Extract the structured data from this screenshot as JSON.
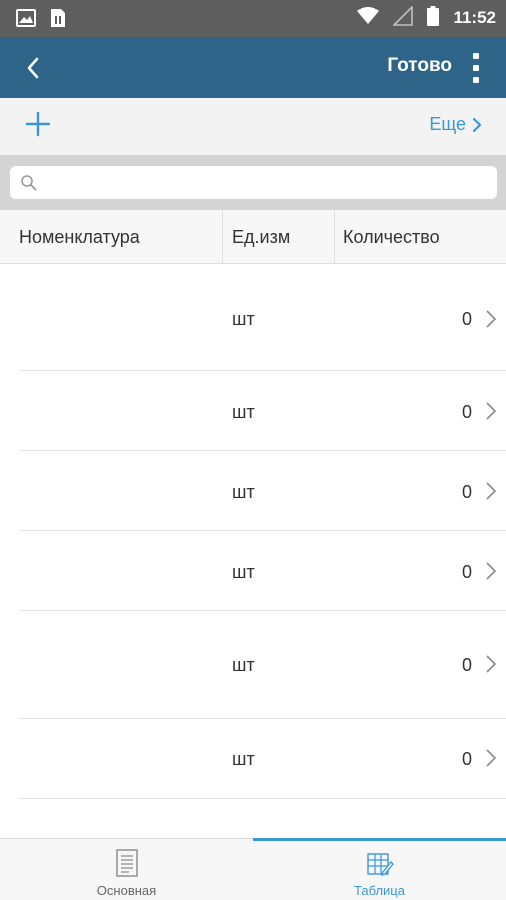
{
  "status_bar": {
    "time": "11:52",
    "icons": [
      "image-icon",
      "sim-card-icon",
      "wifi-icon",
      "signal-icon",
      "battery-icon"
    ]
  },
  "app_bar": {
    "back_icon": "chevron-left-icon",
    "done_label": "Готово",
    "menu_icon": "more-vertical-icon"
  },
  "toolbar": {
    "add_icon": "plus-icon",
    "more_label": "Еще"
  },
  "search": {
    "placeholder": "",
    "value": ""
  },
  "table": {
    "columns": [
      "Номенклатура",
      "Ед.изм",
      "Количество"
    ],
    "rows": [
      {
        "name": "",
        "unit": "шт",
        "qty": "0"
      },
      {
        "name": "",
        "unit": "шт",
        "qty": "0"
      },
      {
        "name": "",
        "unit": "шт",
        "qty": "0"
      },
      {
        "name": "",
        "unit": "шт",
        "qty": "0"
      },
      {
        "name": "",
        "unit": "шт",
        "qty": "0"
      },
      {
        "name": "",
        "unit": "шт",
        "qty": "0"
      }
    ]
  },
  "bottom_nav": {
    "tabs": [
      {
        "label": "Основная",
        "icon": "document-icon",
        "active": false
      },
      {
        "label": "Таблица",
        "icon": "table-edit-icon",
        "active": true
      }
    ]
  },
  "colors": {
    "app_bar": "#2d6488",
    "accent": "#3a97d4",
    "status_bar": "#5e5e5e"
  }
}
